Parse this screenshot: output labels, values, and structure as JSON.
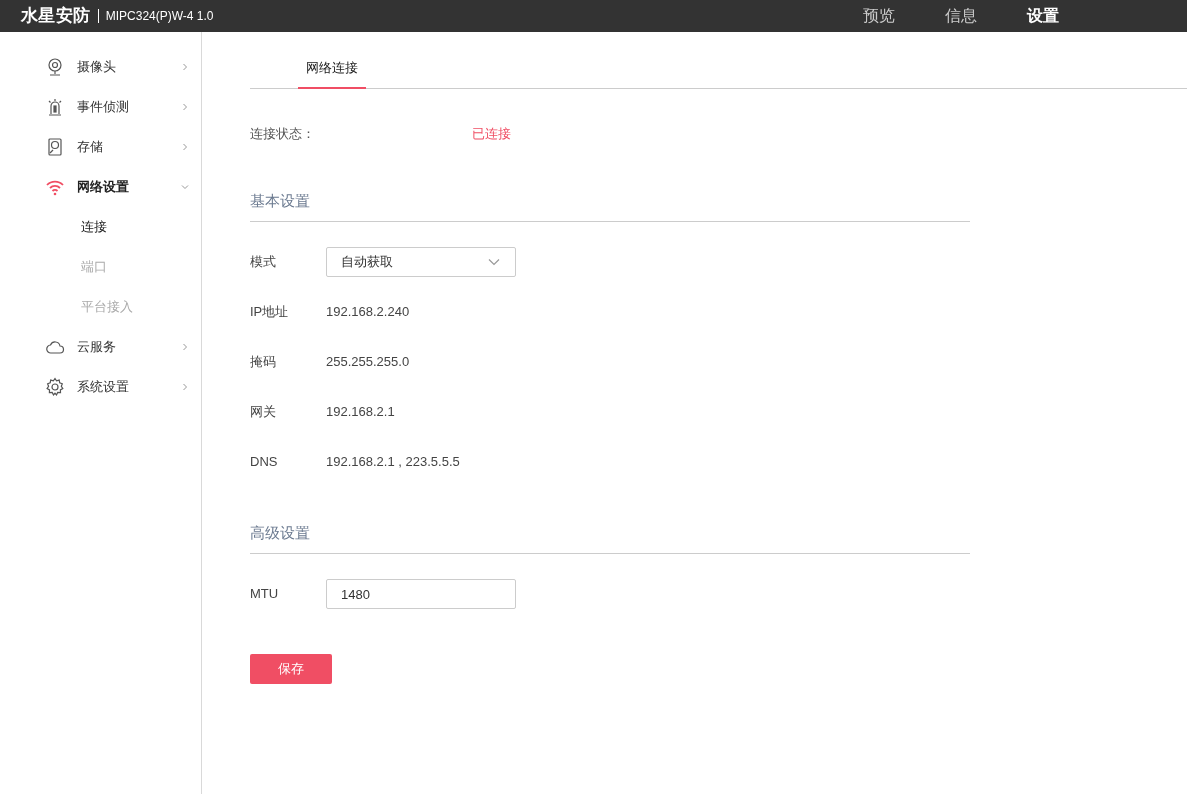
{
  "header": {
    "brand": "水星安防",
    "model": "MIPC324(P)W-4 1.0",
    "nav": [
      {
        "label": "预览",
        "selected": false
      },
      {
        "label": "信息",
        "selected": false
      },
      {
        "label": "设置",
        "selected": true
      }
    ]
  },
  "sidebar": {
    "items": [
      {
        "label": "摄像头",
        "kind": "camera",
        "expanded": false
      },
      {
        "label": "事件侦测",
        "kind": "alarm",
        "expanded": false
      },
      {
        "label": "存储",
        "kind": "disk",
        "expanded": false
      },
      {
        "label": "网络设置",
        "kind": "wifi",
        "expanded": true,
        "children": [
          {
            "label": "连接",
            "selected": true
          },
          {
            "label": "端口",
            "selected": false
          },
          {
            "label": "平台接入",
            "selected": false
          }
        ]
      },
      {
        "label": "云服务",
        "kind": "cloud",
        "expanded": false
      },
      {
        "label": "系统设置",
        "kind": "gear",
        "expanded": false
      }
    ]
  },
  "tabs": [
    {
      "label": "网络连接",
      "selected": true
    }
  ],
  "status": {
    "label": "连接状态：",
    "value": "已连接"
  },
  "sections": [
    {
      "title": "基本设置",
      "rows": [
        {
          "kind": "select",
          "label": "模式",
          "value": "自动获取"
        },
        {
          "kind": "text",
          "label": "IP地址",
          "value": "192.168.2.240"
        },
        {
          "kind": "text",
          "label": "掩码",
          "value": "255.255.255.0"
        },
        {
          "kind": "text",
          "label": "网关",
          "value": "192.168.2.1"
        },
        {
          "kind": "text",
          "label": "DNS",
          "value": "192.168.2.1 , 223.5.5.5"
        }
      ]
    },
    {
      "title": "高级设置",
      "rows": [
        {
          "kind": "input",
          "label": "MTU",
          "value": "1480"
        }
      ]
    }
  ],
  "save_button": "保存"
}
